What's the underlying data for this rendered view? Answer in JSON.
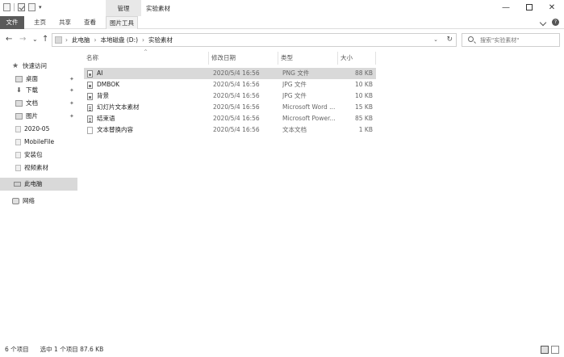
{
  "titlebar": {
    "context_tab": "管理",
    "window_title": "实验素材",
    "minimize": "—",
    "close": "✕"
  },
  "ribbon": {
    "tabs": [
      "文件",
      "主页",
      "共享",
      "查看",
      "图片工具"
    ],
    "help": "?"
  },
  "nav": {
    "back": "←",
    "forward": "→",
    "recent": "⌄",
    "up": "↑"
  },
  "address": {
    "crumbs": [
      "此电脑",
      "本地磁盘 (D:)",
      "实验素材"
    ],
    "separator": "›",
    "refresh": "↻"
  },
  "search": {
    "placeholder": "搜索\"实验素材\""
  },
  "navpane": {
    "items": [
      {
        "label": "快速访问",
        "icon": "star-icon",
        "pinned": false
      },
      {
        "label": "桌面",
        "icon": "desktop-icon",
        "pinned": true
      },
      {
        "label": "下载",
        "icon": "download-icon",
        "pinned": true
      },
      {
        "label": "文档",
        "icon": "documents-icon",
        "pinned": true
      },
      {
        "label": "图片",
        "icon": "pictures-icon",
        "pinned": true
      },
      {
        "label": "2020-05",
        "icon": "folder-icon",
        "pinned": false
      },
      {
        "label": "MobileFile",
        "icon": "folder-icon",
        "pinned": false
      },
      {
        "label": "安装包",
        "icon": "folder-icon",
        "pinned": false
      },
      {
        "label": "视频素材",
        "icon": "folder-icon",
        "pinned": false
      },
      {
        "label": "此电脑",
        "icon": "computer-icon",
        "pinned": false
      },
      {
        "label": "网络",
        "icon": "network-icon",
        "pinned": false
      }
    ],
    "selected": "此电脑",
    "pin_glyph": "✦"
  },
  "columns": {
    "name": "名称",
    "date": "修改日期",
    "type": "类型",
    "size": "大小",
    "sort_glyph": "^"
  },
  "files": [
    {
      "name": "AI",
      "date": "2020/5/4 16:56",
      "type": "PNG 文件",
      "size": "88 KB",
      "icon": "image-file-icon",
      "selected": true
    },
    {
      "name": "DMBOK",
      "date": "2020/5/4 16:56",
      "type": "JPG 文件",
      "size": "10 KB",
      "icon": "image-file-icon",
      "selected": false
    },
    {
      "name": "背景",
      "date": "2020/5/4 16:56",
      "type": "JPG 文件",
      "size": "10 KB",
      "icon": "image-file-icon",
      "selected": false
    },
    {
      "name": "幻灯片文本素材",
      "date": "2020/5/4 16:56",
      "type": "Microsoft Word ...",
      "size": "15 KB",
      "icon": "word-file-icon",
      "selected": false
    },
    {
      "name": "结束语",
      "date": "2020/5/4 16:56",
      "type": "Microsoft Power...",
      "size": "85 KB",
      "icon": "powerpoint-file-icon",
      "selected": false
    },
    {
      "name": "文本替换内容",
      "date": "2020/5/4 16:56",
      "type": "文本文档",
      "size": "1 KB",
      "icon": "text-file-icon",
      "selected": false
    }
  ],
  "status": {
    "count": "6 个项目",
    "selection": "选中 1 个项目  87.6 KB"
  }
}
